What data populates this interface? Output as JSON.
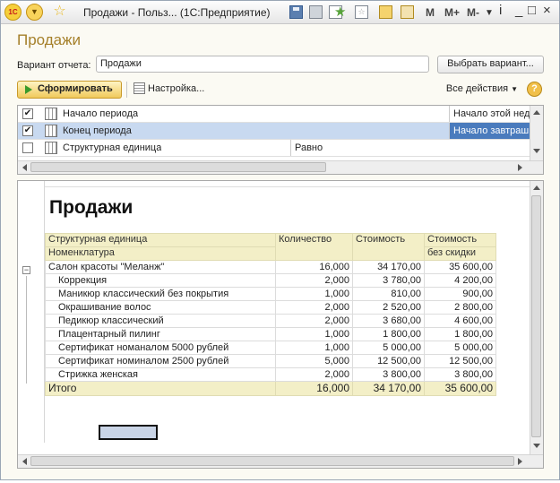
{
  "window": {
    "title": "Продажи - Польз... (1С:Предприятие)",
    "logo": "1С",
    "memory_buttons": [
      "M",
      "M+",
      "M-"
    ]
  },
  "form": {
    "title": "Продажи",
    "variant_label": "Вариант отчета:",
    "variant_value": "Продажи",
    "select_variant_button": "Выбрать вариант...",
    "generate_button": "Сформировать",
    "settings_button": "Настройка...",
    "all_actions_button": "Все действия",
    "help_button": "?"
  },
  "settings": {
    "rows": [
      {
        "checked": true,
        "label": "Начало периода",
        "value": "Начало этой недели",
        "selected": false
      },
      {
        "checked": true,
        "label": "Конец периода",
        "value": "Начало завтрашнего дня",
        "selected": true
      },
      {
        "checked": false,
        "label": "Структурная единица",
        "comparison": "Равно",
        "value": "",
        "selected": false
      }
    ]
  },
  "report": {
    "title": "Продажи",
    "headers": {
      "col1_line1": "Структурная единица",
      "col1_line2": "Номенклатура",
      "col2": "Количество",
      "col3": "Стоимость",
      "col4_line1": "Стоимость",
      "col4_line2": "без скидки"
    },
    "group": {
      "name": "Салон красоты \"Меланж\"",
      "qty": "16,000",
      "cost": "34 170,00",
      "full": "35 600,00"
    },
    "items": [
      {
        "name": "Коррекция",
        "qty": "2,000",
        "cost": "3 780,00",
        "full": "4 200,00"
      },
      {
        "name": "Маникюр классический без покрытия",
        "qty": "1,000",
        "cost": "810,00",
        "full": "900,00"
      },
      {
        "name": "Окрашивание волос",
        "qty": "2,000",
        "cost": "2 520,00",
        "full": "2 800,00"
      },
      {
        "name": "Педикюр классический",
        "qty": "2,000",
        "cost": "3 680,00",
        "full": "4 600,00"
      },
      {
        "name": "Плацентарный пилинг",
        "qty": "1,000",
        "cost": "1 800,00",
        "full": "1 800,00"
      },
      {
        "name": "Сертификат номаналом 5000 рублей",
        "qty": "1,000",
        "cost": "5 000,00",
        "full": "5 000,00"
      },
      {
        "name": "Сертификат номиналом 2500 рублей",
        "qty": "5,000",
        "cost": "12 500,00",
        "full": "12 500,00"
      },
      {
        "name": "Стрижка женская",
        "qty": "2,000",
        "cost": "3 800,00",
        "full": "3 800,00"
      }
    ],
    "total": {
      "label": "Итого",
      "qty": "16,000",
      "cost": "34 170,00",
      "full": "35 600,00"
    }
  },
  "icons": [
    "1c-logo-icon",
    "menu-circle-icon",
    "favorite-star-icon",
    "save-icon",
    "print-icon",
    "preview-icon",
    "add-favorite-icon",
    "favorites-list-icon",
    "calculator-icon",
    "calendar-icon",
    "play-icon",
    "settings-icon",
    "help-icon",
    "period-icon"
  ],
  "colors": {
    "accent": "#a5802a",
    "header_bg": "#f3efc7",
    "selection": "#c8d9f0",
    "selected_value": "#4a7bbd"
  }
}
